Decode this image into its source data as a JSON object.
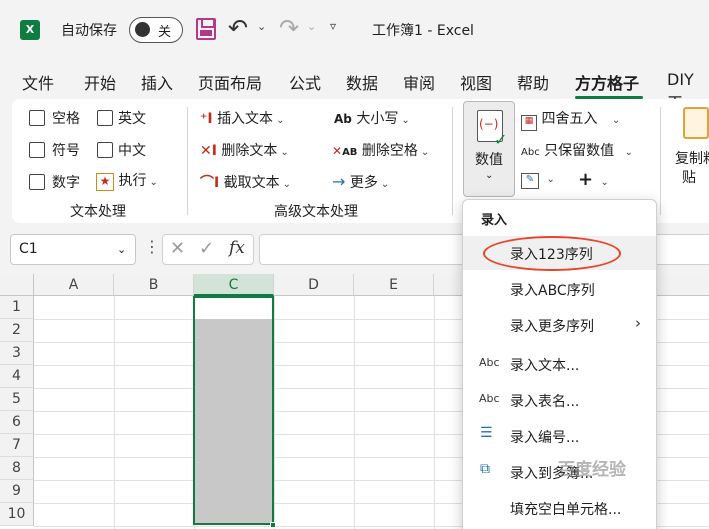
{
  "titlebar": {
    "autosave_label": "自动保存",
    "autosave_state": "关",
    "doc_title": "工作簿1 - Excel"
  },
  "tabs": [
    "文件",
    "开始",
    "插入",
    "页面布局",
    "公式",
    "数据",
    "审阅",
    "视图",
    "帮助",
    "方方格子",
    "DIY工"
  ],
  "active_tab": "方方格子",
  "ribbon": {
    "text_group": {
      "label": "文本处理",
      "checkboxes": [
        "空格",
        "英文",
        "符号",
        "中文",
        "数字"
      ],
      "execute": "执行"
    },
    "advanced_group": {
      "label": "高级文本处理",
      "insert_text": "插入文本",
      "delete_text": "删除文本",
      "extract_text": "截取文本",
      "case_icon": "Ab",
      "case": "大小写",
      "remove_spaces_icon": "AB",
      "remove_spaces": "删除空格",
      "more": "更多"
    },
    "numeric": {
      "label": "数值",
      "round": "四舍五入",
      "keep_values": "只保留数值",
      "plus": "+"
    },
    "clipboard": {
      "label_line1": "复制粘",
      "label_line2": "贴"
    }
  },
  "formula_bar": {
    "name_box": "C1",
    "fx": "fx"
  },
  "grid": {
    "columns": [
      "A",
      "B",
      "C",
      "D",
      "E"
    ],
    "rows": [
      "1",
      "2",
      "3",
      "4",
      "5",
      "6",
      "7",
      "8",
      "9",
      "10"
    ],
    "selected_column": "C"
  },
  "dropdown": {
    "header": "录入",
    "items": [
      {
        "label": "录入123序列",
        "icon": "",
        "has_submenu": false,
        "highlighted": true
      },
      {
        "label": "录入ABC序列",
        "icon": "",
        "has_submenu": false,
        "highlighted": false
      },
      {
        "label": "录入更多序列",
        "icon": "",
        "has_submenu": true,
        "highlighted": false
      },
      {
        "label": "录入文本...",
        "icon": "Abc",
        "has_submenu": false,
        "highlighted": false
      },
      {
        "label": "录入表名...",
        "icon": "Abc",
        "has_submenu": false,
        "highlighted": false
      },
      {
        "label": "录入编号...",
        "icon": "numbered-list-icon",
        "has_submenu": false,
        "highlighted": false
      },
      {
        "label": "录入到多簿...",
        "icon": "multi-workbook-icon",
        "has_submenu": false,
        "highlighted": false
      },
      {
        "label": "填充空白单元格...",
        "icon": "",
        "has_submenu": false,
        "highlighted": false
      }
    ]
  },
  "watermark": "百度经验",
  "colors": {
    "excel_green": "#107c41",
    "accent_red": "#c42b1c",
    "highlight_oval": "#e8432b",
    "selection_fill": "#c8c8c8"
  }
}
